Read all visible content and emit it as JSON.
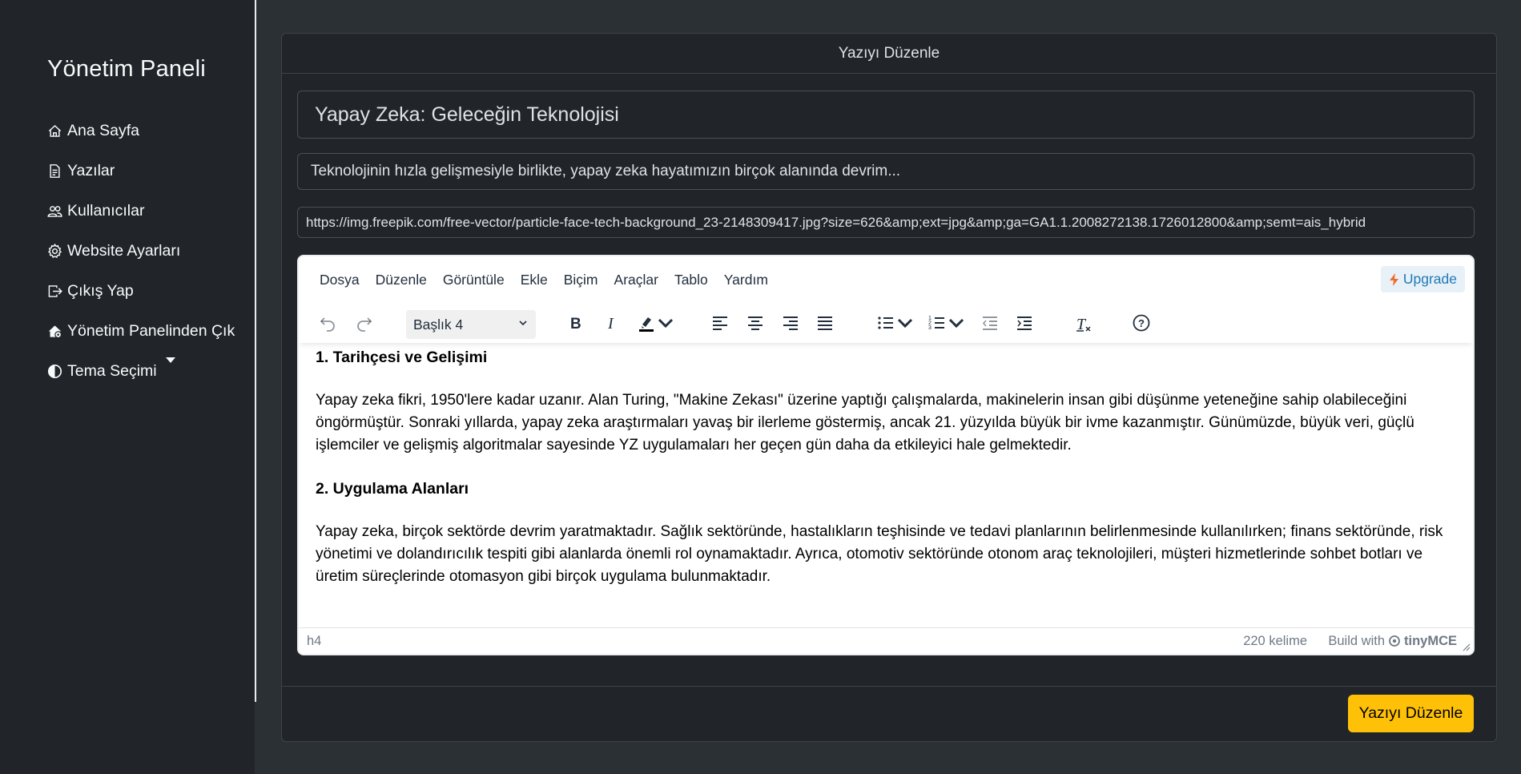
{
  "sidebar": {
    "brand": "Yönetim Paneli",
    "items": [
      {
        "label": "Ana Sayfa",
        "icon": "house-icon"
      },
      {
        "label": "Yazılar",
        "icon": "file-text-icon"
      },
      {
        "label": "Kullanıcılar",
        "icon": "people-icon"
      },
      {
        "label": "Website Ayarları",
        "icon": "gear-icon"
      },
      {
        "label": "Çıkış Yap",
        "icon": "box-arrow-right-icon"
      },
      {
        "label": "Yönetim Panelinden Çık",
        "icon": "house-gear-icon"
      },
      {
        "label": "Tema Seçimi",
        "icon": "circle-half-icon"
      }
    ]
  },
  "card": {
    "header": "Yazıyı Düzenle",
    "title_value": "Yapay Zeka: Geleceğin Teknolojisi",
    "summary_value": "Teknolojinin hızla gelişmesiyle birlikte, yapay zeka hayatımızın birçok alanında devrim...",
    "image_url_value": "https://img.freepik.com/free-vector/particle-face-tech-background_23-2148309417.jpg?size=626&amp;ext=jpg&amp;ga=GA1.1.2008272138.1726012800&amp;semt=ais_hybrid",
    "submit_label": "Yazıyı Düzenle"
  },
  "editor": {
    "menu": [
      "Dosya",
      "Düzenle",
      "Görüntüle",
      "Ekle",
      "Biçim",
      "Araçlar",
      "Tablo",
      "Yardım"
    ],
    "upgrade_label": "Upgrade",
    "block_format": "Başlık 4",
    "content": {
      "h1": "1. Tarihçesi ve Gelişimi",
      "p1": "Yapay zeka fikri, 1950'lere kadar uzanır. Alan Turing, \"Makine Zekası\" üzerine yaptığı çalışmalarda, makinelerin insan gibi düşünme yeteneğine sahip olabileceğini öngörmüştür. Sonraki yıllarda, yapay zeka araştırmaları yavaş bir ilerleme göstermiş, ancak 21. yüzyılda büyük bir ivme kazanmıştır. Günümüzde, büyük veri, güçlü işlemciler ve gelişmiş algoritmalar sayesinde YZ uygulamaları her geçen gün daha da etkileyici hale gelmektedir.",
      "h2": "2. Uygulama Alanları",
      "p2": "Yapay zeka, birçok sektörde devrim yaratmaktadır. Sağlık sektöründe, hastalıkların teşhisinde ve tedavi planlarının belirlenmesinde kullanılırken; finans sektöründe, risk yönetimi ve dolandırıcılık tespiti gibi alanlarda önemli rol oynamaktadır. Ayrıca, otomotiv sektöründe otonom araç teknolojileri, müşteri hizmetlerinde sohbet botları ve üretim süreçlerinde otomasyon gibi birçok uygulama bulunmaktadır."
    },
    "status": {
      "path": "h4",
      "word_count": "220 kelime",
      "build_with": "Build with",
      "brand": "tinyMCE"
    }
  },
  "colors": {
    "background": "#2b3035",
    "sidebar": "#212529",
    "accent_button": "#ffc107",
    "upgrade": "#207ab7"
  }
}
